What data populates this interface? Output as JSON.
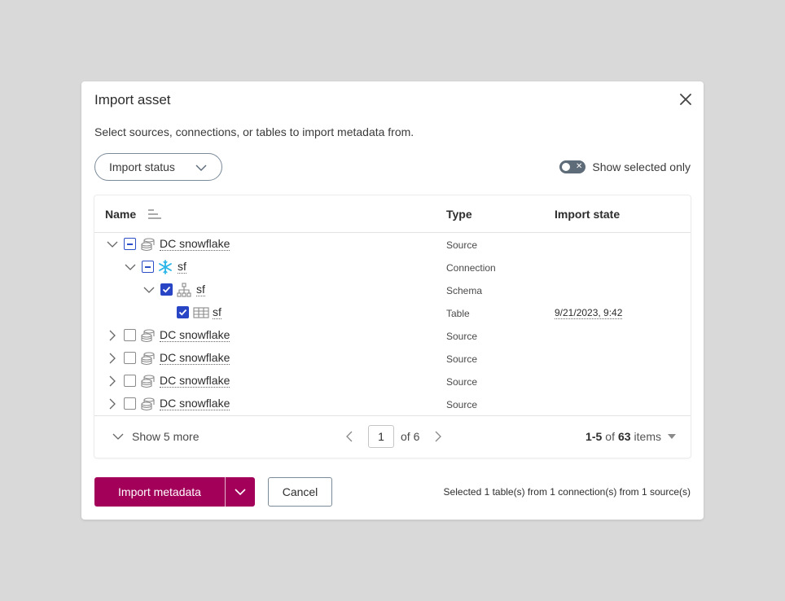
{
  "dialog": {
    "title": "Import asset",
    "subtitle": "Select sources, connections, or tables to import metadata from."
  },
  "filter": {
    "label": "Import status"
  },
  "toggle": {
    "label": "Show selected only",
    "on": false
  },
  "table": {
    "columns": {
      "name": "Name",
      "type": "Type",
      "state": "Import state"
    },
    "rows": [
      {
        "name": "DC snowflake",
        "type": "Source",
        "state": ""
      },
      {
        "name": "sf",
        "type": "Connection",
        "state": ""
      },
      {
        "name": "sf",
        "type": "Schema",
        "state": ""
      },
      {
        "name": "sf",
        "type": "Table",
        "state": "9/21/2023, 9:42"
      },
      {
        "name": "DC snowflake",
        "type": "Source",
        "state": ""
      },
      {
        "name": "DC snowflake",
        "type": "Source",
        "state": ""
      },
      {
        "name": "DC snowflake",
        "type": "Source",
        "state": ""
      },
      {
        "name": "DC snowflake",
        "type": "Source",
        "state": ""
      }
    ]
  },
  "footer": {
    "show_more": "Show 5 more",
    "page": "1",
    "of_pages": "of 6",
    "range": "1-5",
    "of": "of",
    "total": "63",
    "items_label": "items"
  },
  "actions": {
    "primary": "Import metadata",
    "cancel": "Cancel",
    "summary": "Selected 1 table(s) from 1 connection(s) from 1 source(s)"
  },
  "colors": {
    "primary": "#a3005a",
    "checkbox": "#2845c6",
    "snowflake": "#29b5e8"
  }
}
